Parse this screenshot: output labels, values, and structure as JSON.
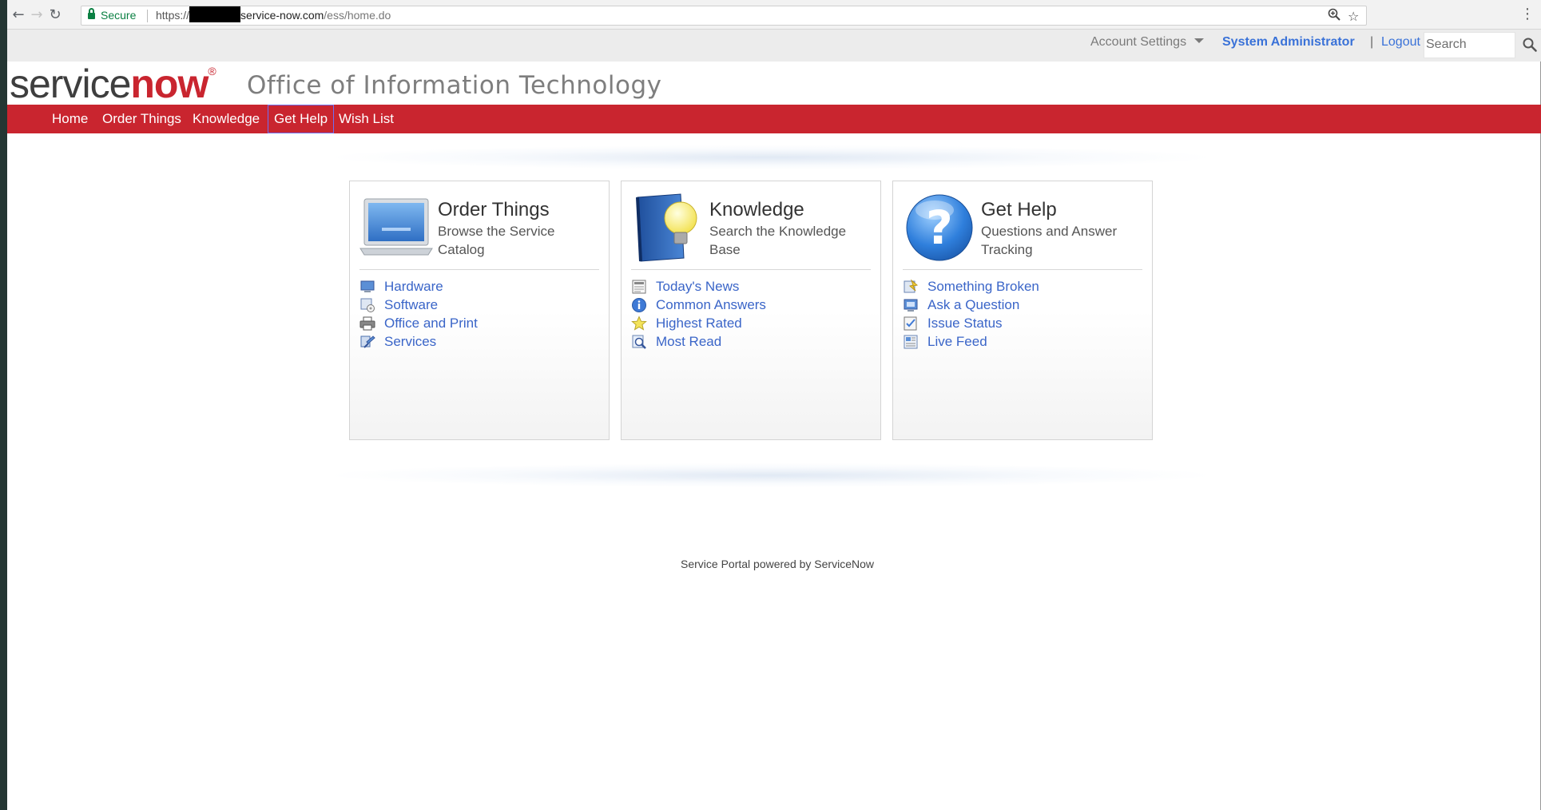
{
  "browser": {
    "secure_label": "Secure",
    "url_prefix": "https://",
    "url_host": "service-now.com",
    "url_path": "/ess/home.do"
  },
  "utility": {
    "account_settings": "Account Settings",
    "user_name": "System Administrator",
    "separator": "|",
    "logout": "Logout",
    "search_placeholder": "Search"
  },
  "header": {
    "logo_service": "service",
    "logo_now": "now",
    "logo_reg": "®",
    "department": "Office of Information Technology"
  },
  "menu": {
    "items": [
      {
        "label": "Home"
      },
      {
        "label": "Order Things"
      },
      {
        "label": "Knowledge"
      },
      {
        "label": "Get Help"
      },
      {
        "label": "Wish List"
      }
    ],
    "active": "Get Help"
  },
  "cards": [
    {
      "title": "Order Things",
      "subtitle": "Browse the Service Catalog",
      "icon": "laptop-icon",
      "links": [
        {
          "label": "Hardware",
          "icon": "monitor-icon"
        },
        {
          "label": "Software",
          "icon": "software-icon"
        },
        {
          "label": "Office and Print",
          "icon": "printer-icon"
        },
        {
          "label": "Services",
          "icon": "services-icon"
        }
      ]
    },
    {
      "title": "Knowledge",
      "subtitle": "Search the Knowledge Base",
      "icon": "book-lightbulb-icon",
      "links": [
        {
          "label": "Today's News",
          "icon": "news-icon"
        },
        {
          "label": "Common Answers",
          "icon": "info-icon"
        },
        {
          "label": "Highest Rated",
          "icon": "star-icon"
        },
        {
          "label": "Most Read",
          "icon": "magnifier-icon"
        }
      ]
    },
    {
      "title": "Get Help",
      "subtitle": "Questions and Answer Tracking",
      "icon": "question-mark-icon",
      "links": [
        {
          "label": "Something Broken",
          "icon": "broken-icon"
        },
        {
          "label": "Ask a Question",
          "icon": "ask-icon"
        },
        {
          "label": "Issue Status",
          "icon": "status-icon"
        },
        {
          "label": "Live Feed",
          "icon": "feed-icon"
        }
      ]
    }
  ],
  "footer": {
    "text": "Service Portal powered by ServiceNow"
  },
  "colors": {
    "brand_red": "#c9252f",
    "link_blue": "#3a65c8",
    "user_blue": "#3a72d8"
  }
}
